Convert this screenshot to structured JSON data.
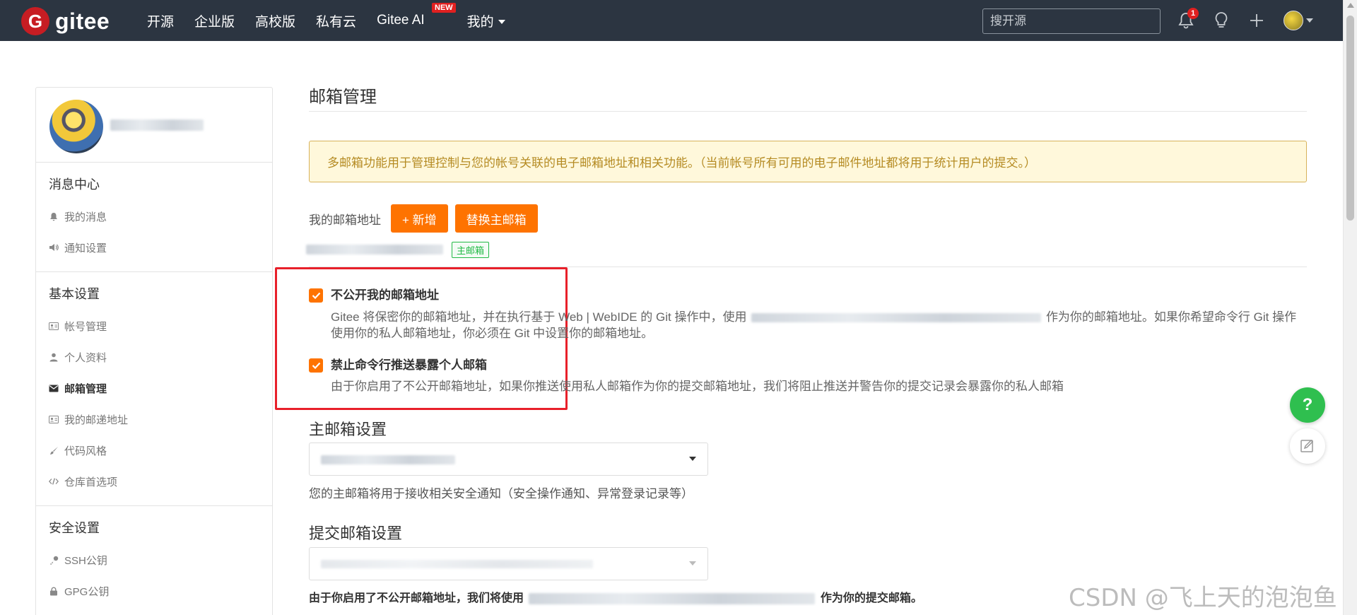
{
  "topnav": {
    "logo_text": "gitee",
    "links": [
      "开源",
      "企业版",
      "高校版",
      "私有云",
      "Gitee AI",
      "我的"
    ],
    "new_badge": "NEW",
    "search_placeholder": "搜开源",
    "notification_count": "1"
  },
  "sidebar": {
    "groups": [
      {
        "title": "消息中心",
        "items": [
          {
            "label": "我的消息",
            "icon": "bell-icon"
          },
          {
            "label": "通知设置",
            "icon": "speaker-icon"
          }
        ]
      },
      {
        "title": "基本设置",
        "items": [
          {
            "label": "帐号管理",
            "icon": "id-card-icon"
          },
          {
            "label": "个人资料",
            "icon": "user-icon"
          },
          {
            "label": "邮箱管理",
            "icon": "envelope-icon",
            "active": true
          },
          {
            "label": "我的邮递地址",
            "icon": "address-card-icon"
          },
          {
            "label": "代码风格",
            "icon": "brush-icon"
          },
          {
            "label": "仓库首选项",
            "icon": "code-icon"
          }
        ]
      },
      {
        "title": "安全设置",
        "items": [
          {
            "label": "SSH公钥",
            "icon": "key-icon"
          },
          {
            "label": "GPG公钥",
            "icon": "lock-icon"
          }
        ]
      }
    ]
  },
  "main": {
    "title": "邮箱管理",
    "notice": "多邮箱功能用于管理控制与您的帐号关联的电子邮箱地址和相关功能。（当前帐号所有可用的电子邮件地址都将用于统计用户的提交。）",
    "my_email_label": "我的邮箱地址",
    "add_button": "+ 新增",
    "replace_button": "替换主邮箱",
    "primary_tag": "主邮箱",
    "option1": {
      "title": "不公开我的邮箱地址",
      "desc_part1": "Gitee 将保密你的邮箱地址，并在执行基于 Web | WebIDE 的 Git 操作中，使用",
      "desc_part2": "作为你的邮箱地址。如果你希望命令行 Git 操作使用你的私人邮箱地址，你必须在 Git 中设置你的邮箱地址。",
      "checked": true
    },
    "option2": {
      "title": "禁止命令行推送暴露个人邮箱",
      "desc": "由于你启用了不公开邮箱地址，如果你推送使用私人邮箱作为你的提交邮箱地址，我们将阻止推送并警告你的提交记录会暴露你的私人邮箱",
      "checked": true
    },
    "primary_section_title": "主邮箱设置",
    "primary_helper": "您的主邮箱将用于接收相关安全通知（安全操作通知、异常登录记录等）",
    "commit_section_title": "提交邮箱设置",
    "commit_note_part1": "由于你启用了不公开邮箱地址，我们将使用",
    "commit_note_part2": "作为你的提交邮箱。"
  },
  "floating": {
    "help_label": "?"
  },
  "watermark": "CSDN @飞上天的泡泡鱼",
  "colors": {
    "nav_bg": "#2c3541",
    "brand_red": "#c71d23",
    "accent_orange": "#fe7300",
    "notice_bg": "#fff8db",
    "success_green": "#21ba45",
    "highlight_red": "#e8202a"
  }
}
